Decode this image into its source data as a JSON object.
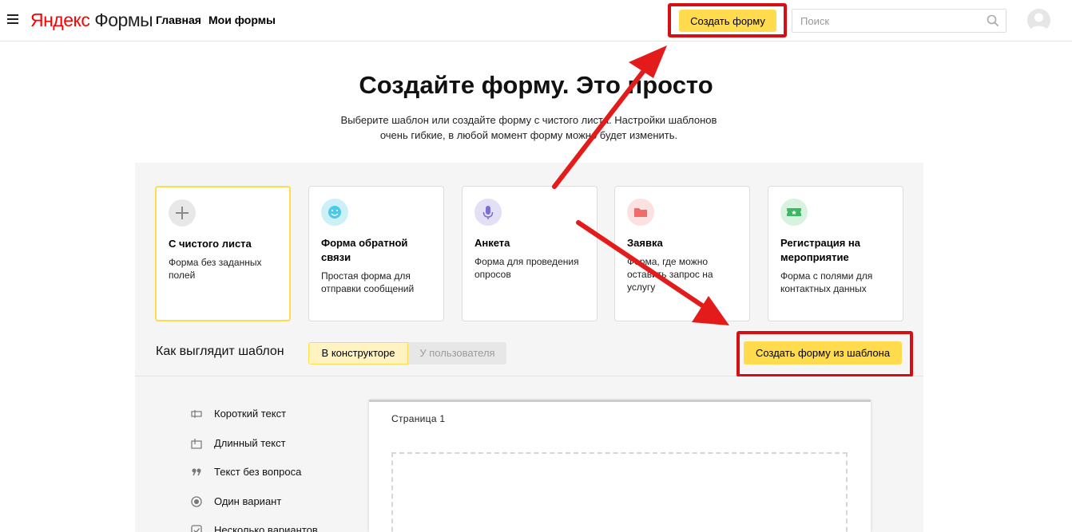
{
  "header": {
    "logo_part1": "Яндекс",
    "logo_part2": "Формы",
    "nav": [
      "Главная",
      "Мои формы"
    ],
    "create_button": "Создать форму",
    "search_placeholder": "Поиск"
  },
  "hero": {
    "title": "Создайте форму. Это просто",
    "subtitle_line1": "Выберите шаблон или создайте форму с чистого листа. Настройки шаблонов",
    "subtitle_line2": "очень гибкие, в любой момент форму можно будет изменить."
  },
  "templates": [
    {
      "title": "С чистого листа",
      "description": "Форма без заданных полей",
      "icon": "plus-icon",
      "color": "#e8e8e8",
      "selected": true
    },
    {
      "title": "Форма обратной связи",
      "description": "Простая форма для отправки сообщений",
      "icon": "smile-icon",
      "color": "#ccf0f8"
    },
    {
      "title": "Анкета",
      "description": "Форма для проведения опросов",
      "icon": "microphone-icon",
      "color": "#e3e0f6"
    },
    {
      "title": "Заявка",
      "description": "Форма, где можно оставить запрос на услугу",
      "icon": "folder-icon",
      "color": "#fde0e0"
    },
    {
      "title": "Регистрация на мероприятие",
      "description": "Форма с полями для контактных данных",
      "icon": "ticket-icon",
      "color": "#d7f2df"
    }
  ],
  "preview": {
    "label": "Как выглядит шаблон",
    "tab_constructor": "В конструкторе",
    "tab_user": "У пользователя",
    "create_from_template": "Создать форму из шаблона"
  },
  "fields": [
    {
      "label": "Короткий текст",
      "icon": "short-text-icon"
    },
    {
      "label": "Длинный текст",
      "icon": "long-text-icon"
    },
    {
      "label": "Текст без вопроса",
      "icon": "quote-icon"
    },
    {
      "label": "Один вариант",
      "icon": "radio-icon"
    },
    {
      "label": "Несколько вариантов",
      "icon": "checkbox-icon"
    }
  ],
  "canvas": {
    "page_label": "Страница 1"
  },
  "colors": {
    "accent_yellow": "#ffdb4d",
    "highlight_red": "#d50f14"
  }
}
